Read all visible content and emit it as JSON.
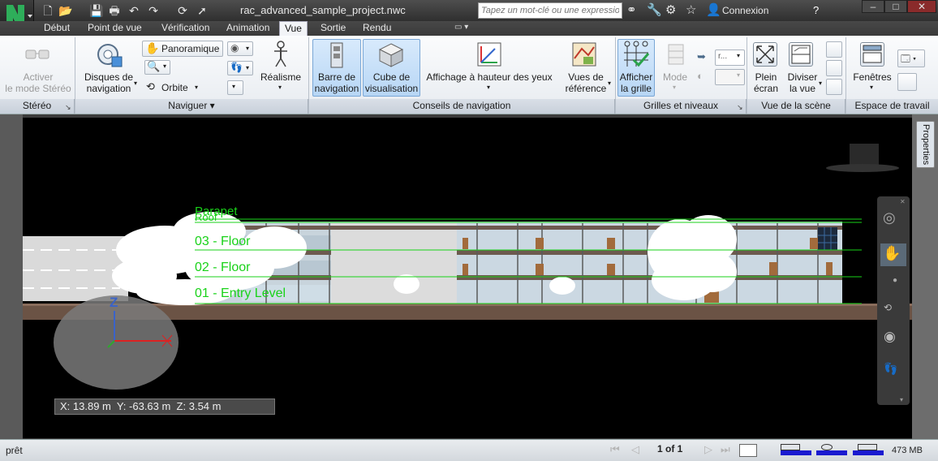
{
  "app": {
    "doc_title": "rac_advanced_sample_project.nwc",
    "search_placeholder": "Tapez un mot-clé ou une expression",
    "login_label": "Connexion"
  },
  "tabs": [
    "Début",
    "Point de vue",
    "Vérification",
    "Animation",
    "Vue",
    "Sortie",
    "Rendu"
  ],
  "active_tab": "Vue",
  "ribbon": {
    "stereo": {
      "button_label_1": "Activer",
      "button_label_2": "le mode Stéréo",
      "panel_title": "Stéréo"
    },
    "naviguer": {
      "disques_1": "Disques de",
      "disques_2": "navigation",
      "panoramique": "Panoramique",
      "orbite": "Orbite",
      "realisme": "Réalisme",
      "panel_title": "Naviguer"
    },
    "conseils": {
      "barre_1": "Barre de",
      "barre_2": "navigation",
      "cube_1": "Cube de",
      "cube_2": "visualisation",
      "affichage": "Affichage à hauteur des yeux",
      "vues_1": "Vues de",
      "vues_2": "référence",
      "panel_title": "Conseils de navigation"
    },
    "grilles": {
      "afficher_1": "Afficher",
      "afficher_2": "la grille",
      "mode": "Mode",
      "dropdown_value": "r...",
      "panel_title": "Grilles et niveaux"
    },
    "scene": {
      "plein_1": "Plein",
      "plein_2": "écran",
      "diviser_1": "Diviser",
      "diviser_2": "la vue",
      "panel_title": "Vue de la scène"
    },
    "espace": {
      "fenetres": "Fenêtres",
      "panel_title": "Espace de travail"
    }
  },
  "viewport": {
    "levels": [
      "Parapet",
      "Roof",
      "03 - Floor",
      "02 - Floor",
      "01 - Entry Level"
    ],
    "axis_z": "Z",
    "coords": "X: 13.89 m  Y: -63.63 m  Z: 3.54 m",
    "properties_tab": "Properties"
  },
  "status": {
    "ready": "prêt",
    "page": "1 of 1",
    "memory": "473 MB"
  }
}
